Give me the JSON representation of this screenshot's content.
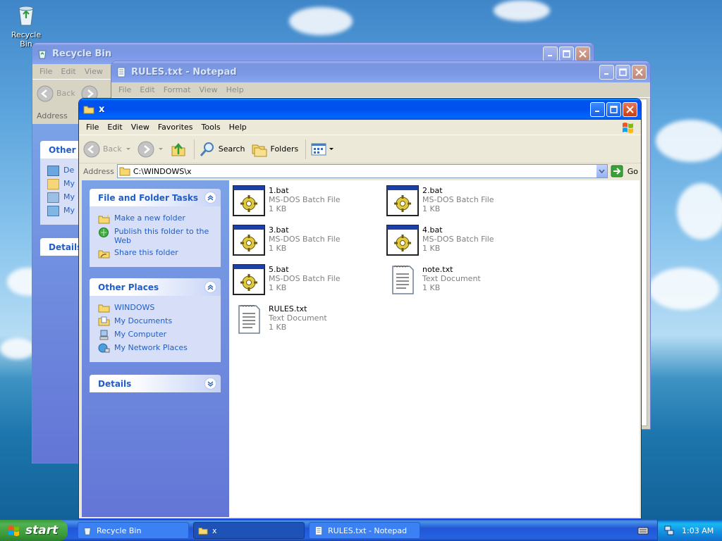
{
  "desktop": {
    "recycle_bin_label": "Recycle Bin"
  },
  "recycle_window": {
    "title": "Recycle Bin",
    "menus": [
      "File",
      "Edit",
      "View"
    ],
    "back_label": "Back",
    "address_label": "Address",
    "other_places_header": "Other P",
    "places": [
      "De",
      "My",
      "My",
      "My"
    ],
    "details_header": "Details"
  },
  "notepad_window": {
    "title": "RULES.txt - Notepad",
    "menus": [
      "File",
      "Edit",
      "Format",
      "View",
      "Help"
    ]
  },
  "explorer_window": {
    "title": "x",
    "menus": [
      "File",
      "Edit",
      "View",
      "Favorites",
      "Tools",
      "Help"
    ],
    "toolbar": {
      "back": "Back",
      "search": "Search",
      "folders": "Folders"
    },
    "address_label": "Address",
    "address_value": "C:\\WINDOWS\\x",
    "go_label": "Go",
    "tasks": {
      "header": "File and Folder Tasks",
      "items": [
        "Make a new folder",
        "Publish this folder to the Web",
        "Share this folder"
      ]
    },
    "other_places": {
      "header": "Other Places",
      "items": [
        "WINDOWS",
        "My Documents",
        "My Computer",
        "My Network Places"
      ]
    },
    "details": {
      "header": "Details"
    },
    "files": [
      {
        "name": "1.bat",
        "type": "MS-DOS Batch File",
        "size": "1 KB",
        "icon": "batch-file-icon"
      },
      {
        "name": "2.bat",
        "type": "MS-DOS Batch File",
        "size": "1 KB",
        "icon": "batch-file-icon"
      },
      {
        "name": "3.bat",
        "type": "MS-DOS Batch File",
        "size": "1 KB",
        "icon": "batch-file-icon"
      },
      {
        "name": "4.bat",
        "type": "MS-DOS Batch File",
        "size": "1 KB",
        "icon": "batch-file-icon"
      },
      {
        "name": "5.bat",
        "type": "MS-DOS Batch File",
        "size": "1 KB",
        "icon": "batch-file-icon"
      },
      {
        "name": "note.txt",
        "type": "Text Document",
        "size": "1 KB",
        "icon": "text-document-icon"
      },
      {
        "name": "RULES.txt",
        "type": "Text Document",
        "size": "1 KB",
        "icon": "text-document-icon"
      }
    ]
  },
  "taskbar": {
    "start_label": "start",
    "tasks": [
      {
        "label": "Recycle Bin",
        "active": false
      },
      {
        "label": "x",
        "active": true
      },
      {
        "label": "RULES.txt - Notepad",
        "active": false
      }
    ],
    "clock": "1:03 AM"
  },
  "colors": {
    "xp_blue": "#0053ee",
    "link_blue": "#215dc6",
    "start_green": "#3a9b3a"
  }
}
